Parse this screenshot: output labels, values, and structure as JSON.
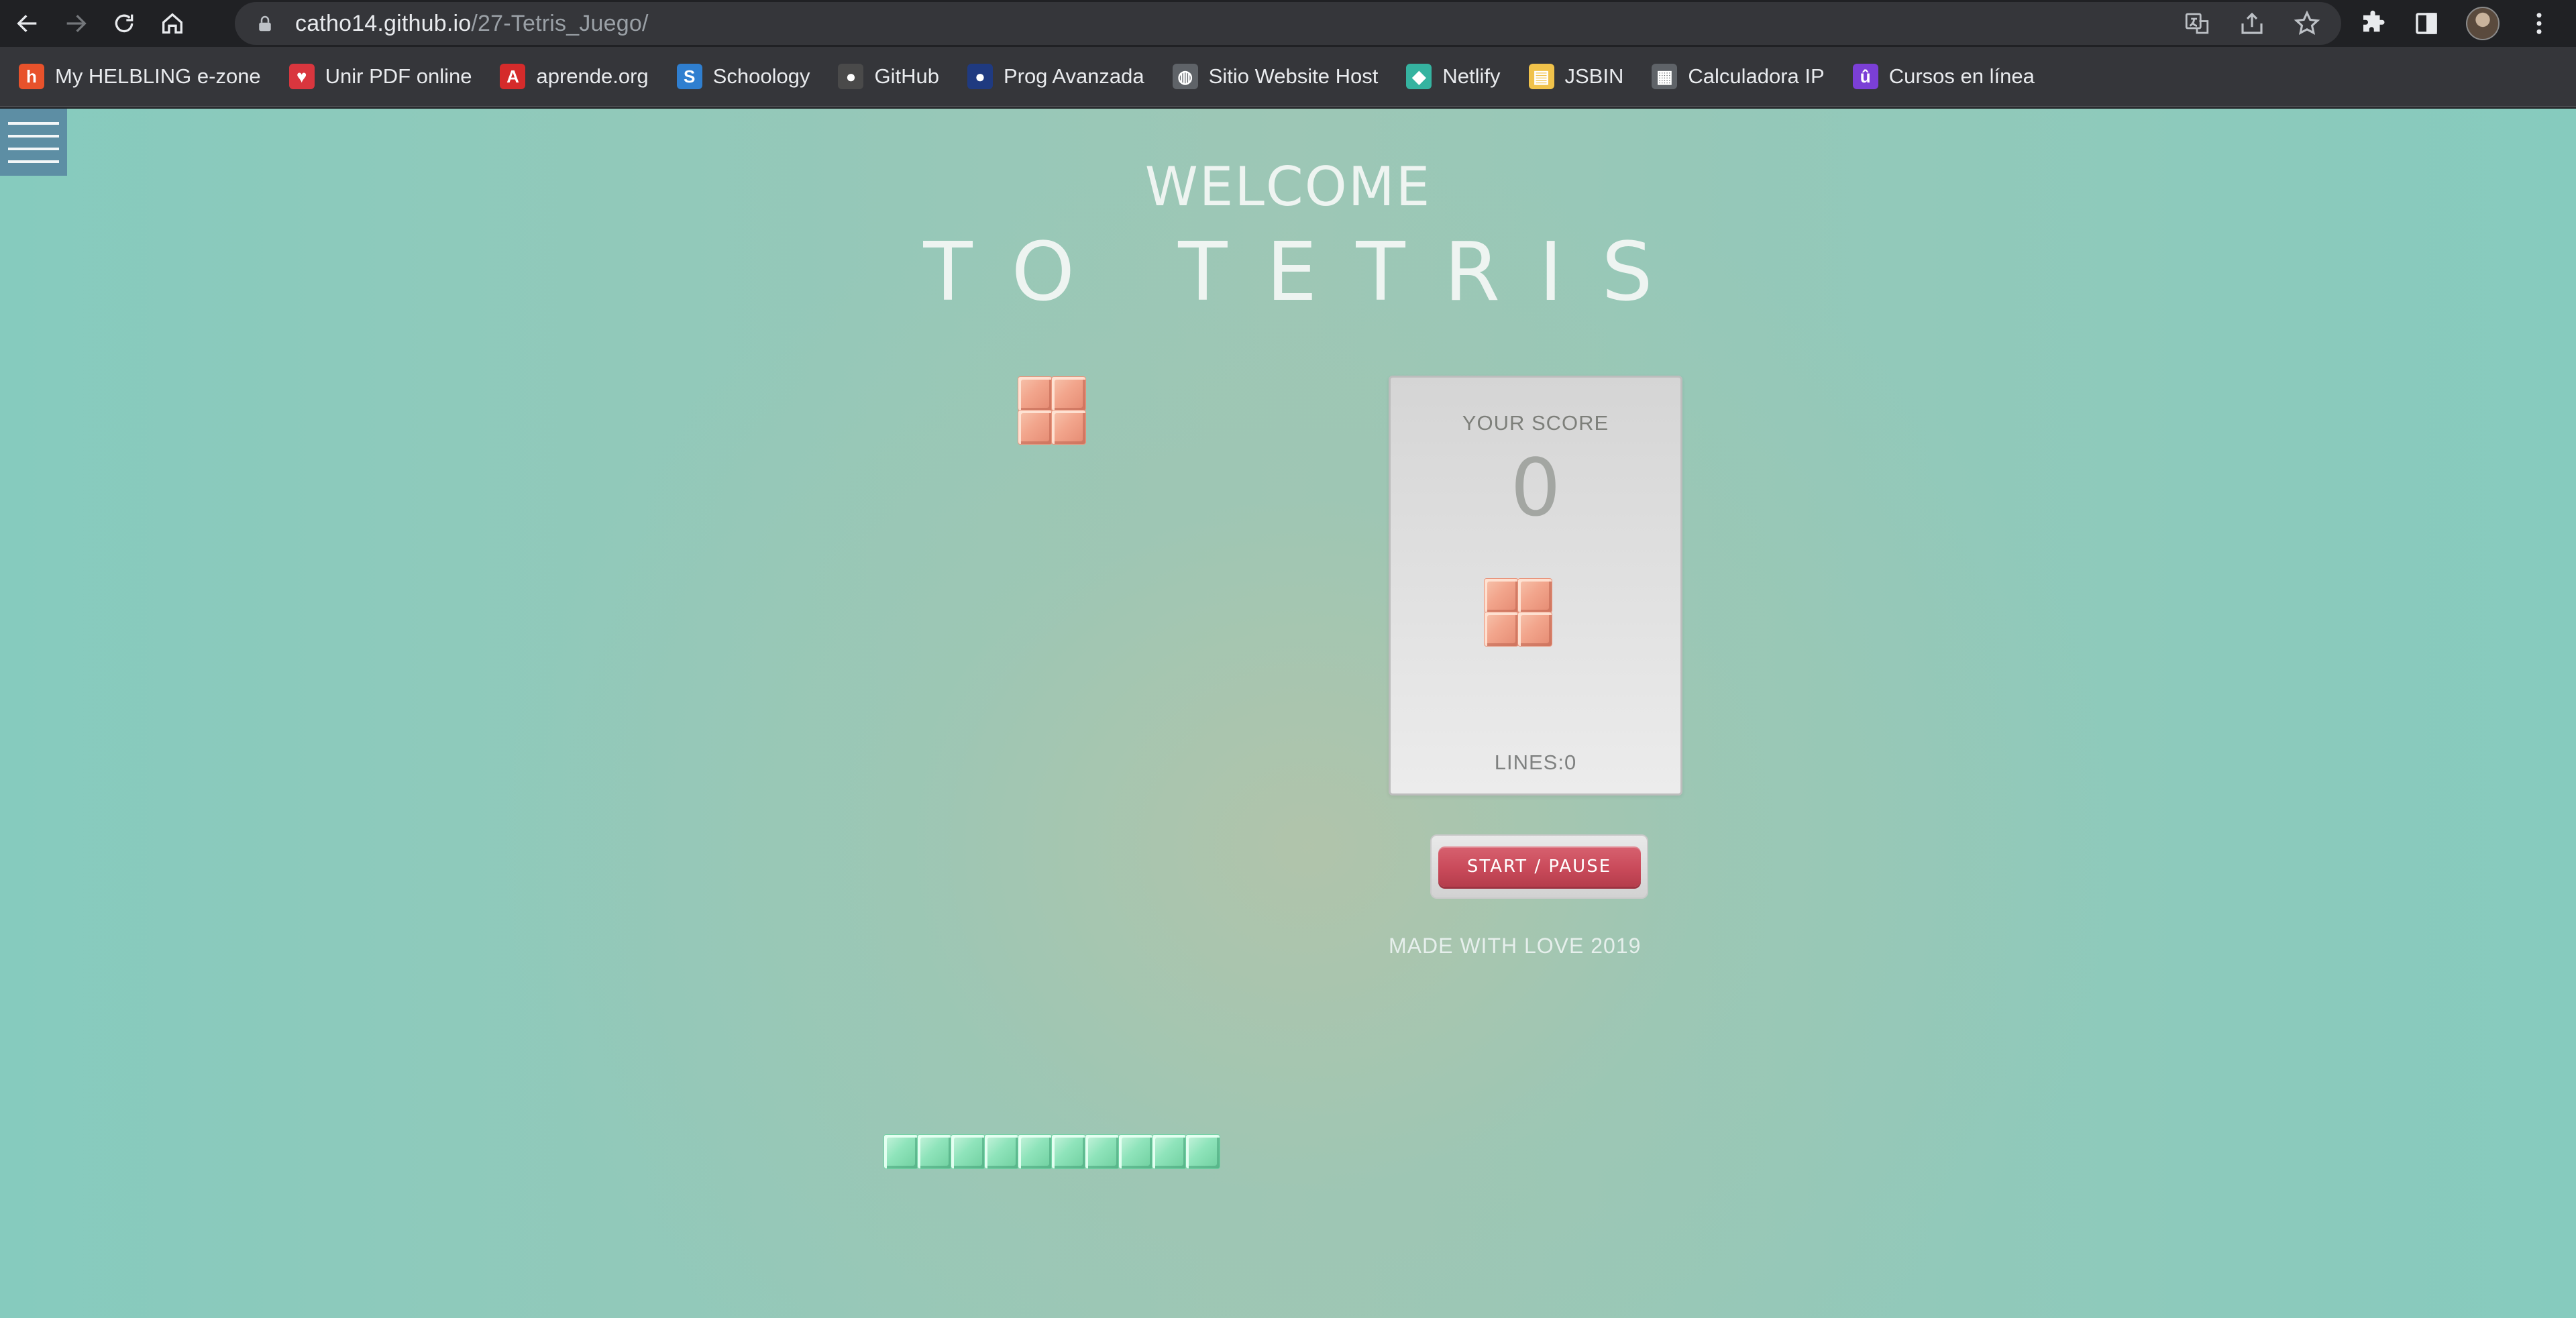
{
  "browser": {
    "url_host": "catho14.github.io",
    "url_path": "/27-Tetris_Juego/",
    "bookmarks": [
      {
        "label": "My HELBLING e-zone",
        "icon": "helbling-icon",
        "color": "#e8522b",
        "glyph": "h"
      },
      {
        "label": "Unir PDF online",
        "icon": "heart-pdf-icon",
        "color": "#d9363e",
        "glyph": "♥"
      },
      {
        "label": "aprende.org",
        "icon": "aprende-icon",
        "color": "#d52b2b",
        "glyph": "A"
      },
      {
        "label": "Schoology",
        "icon": "schoology-icon",
        "color": "#2f7fd0",
        "glyph": "S"
      },
      {
        "label": "GitHub",
        "icon": "github-icon",
        "color": "#4a4a4a",
        "glyph": "●"
      },
      {
        "label": "Prog Avanzada",
        "icon": "prog-avanzada-icon",
        "color": "#1f3a80",
        "glyph": "●"
      },
      {
        "label": "Sitio Website Host",
        "icon": "globe-icon",
        "color": "#5f6368",
        "glyph": "◍"
      },
      {
        "label": "Netlify",
        "icon": "netlify-icon",
        "color": "#35b3a0",
        "glyph": "◆"
      },
      {
        "label": "JSBIN",
        "icon": "jsbin-icon",
        "color": "#f0c24a",
        "glyph": "▤"
      },
      {
        "label": "Calculadora IP",
        "icon": "calculator-icon",
        "color": "#5f6368",
        "glyph": "▦"
      },
      {
        "label": "Cursos en línea",
        "icon": "cursos-icon",
        "color": "#7b3fd6",
        "glyph": "û"
      }
    ]
  },
  "page": {
    "title_line1": "WELCOME",
    "title_line2": "TO TETRIS",
    "score_label": "YOUR SCORE",
    "score_value": "0",
    "lines_label": "LINES:0",
    "start_button": "START / PAUSE",
    "credit": "MADE WITH LOVE 2019",
    "colors": {
      "orange_piece": "#f2a58c",
      "green_piece": "#8fe4bb",
      "button_red": "#c94a5a",
      "menu_blue": "#5d8ea4"
    }
  }
}
